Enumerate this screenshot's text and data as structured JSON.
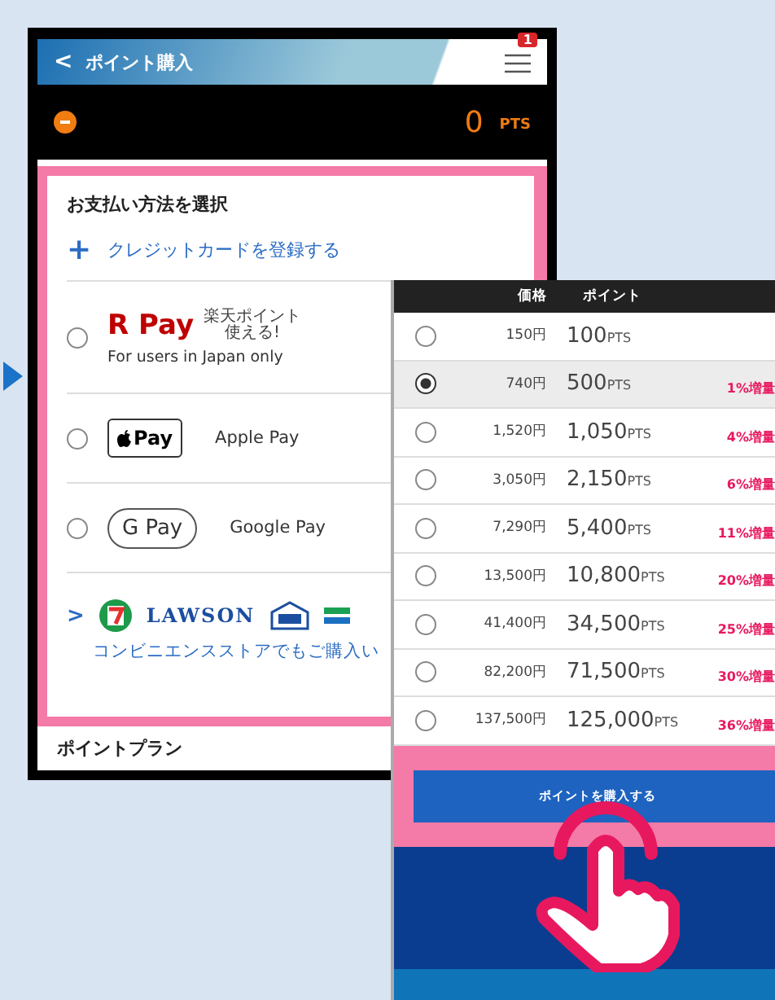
{
  "left_screen": {
    "header": {
      "back": "<",
      "title": "ポイント購入",
      "menu_badge": "1"
    },
    "balance": {
      "value": "0",
      "unit": "PTS"
    },
    "payment": {
      "heading": "お支払い方法を選択",
      "add_card": {
        "icon": "+",
        "label": "クレジットカードを登録する"
      },
      "methods": [
        {
          "kind": "rpay",
          "logo": "R Pay",
          "tag": [
            "楽天ポイント",
            "使える!"
          ],
          "note": "For users in Japan only",
          "selected": false
        },
        {
          "kind": "applepay",
          "logo": "Pay",
          "label": "Apple Pay",
          "selected": false
        },
        {
          "kind": "googlepay",
          "logo": "G Pay",
          "label": "Google Pay",
          "selected": false
        },
        {
          "kind": "convenience",
          "chevron": ">",
          "logo": "LAWSON",
          "note": "コンビニエンスストアでもご購入い"
        }
      ]
    },
    "plan_heading": "ポイントプラン"
  },
  "right_screen": {
    "columns": [
      "価格",
      "ポイント"
    ],
    "rows": [
      {
        "price": "150円",
        "points": "100",
        "unit": "PTS",
        "bonus": "",
        "selected": false
      },
      {
        "price": "740円",
        "points": "500",
        "unit": "PTS",
        "bonus": "1%増量",
        "selected": true
      },
      {
        "price": "1,520円",
        "points": "1,050",
        "unit": "PTS",
        "bonus": "4%増量",
        "selected": false
      },
      {
        "price": "3,050円",
        "points": "2,150",
        "unit": "PTS",
        "bonus": "6%増量",
        "selected": false
      },
      {
        "price": "7,290円",
        "points": "5,400",
        "unit": "PTS",
        "bonus": "11%増量",
        "selected": false
      },
      {
        "price": "13,500円",
        "points": "10,800",
        "unit": "PTS",
        "bonus": "20%増量",
        "selected": false
      },
      {
        "price": "41,400円",
        "points": "34,500",
        "unit": "PTS",
        "bonus": "25%増量",
        "selected": false
      },
      {
        "price": "82,200円",
        "points": "71,500",
        "unit": "PTS",
        "bonus": "30%増量",
        "selected": false
      },
      {
        "price": "137,500円",
        "points": "125,000",
        "unit": "PTS",
        "bonus": "36%増量",
        "selected": false
      }
    ],
    "buy_button": "ポイントを購入する"
  }
}
